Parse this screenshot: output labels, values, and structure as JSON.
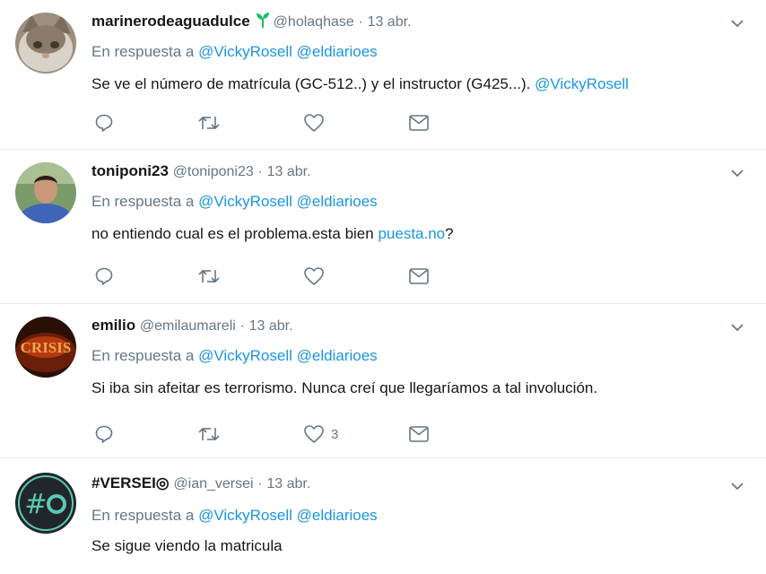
{
  "colors": {
    "link": "#1b95e0",
    "muted": "#657786",
    "text": "#14171a",
    "sprout": "#17bf63"
  },
  "tweets": [
    {
      "name": "marinerodeaguadulce",
      "handle": "@holaqhase",
      "dot": "·",
      "time": "13 abr.",
      "reply_prefix": "En respuesta a",
      "mentions": [
        "@VickyRosell",
        "@eldiarioes"
      ],
      "text": "Se ve el número de matrícula (GC-512..) y el instructor (G425...).",
      "text_link": "@VickyRosell",
      "text_suffix": "",
      "like_count": "",
      "icons": [
        "reply-icon",
        "retweet-icon",
        "heart-icon",
        "message-icon"
      ]
    },
    {
      "name": "toniponi23",
      "handle": "@toniponi23",
      "dot": "·",
      "time": "13 abr.",
      "reply_prefix": "En respuesta a",
      "mentions": [
        "@VickyRosell",
        "@eldiarioes"
      ],
      "text": "no entiendo cual es el problema.esta bien",
      "text_link": "puesta.no",
      "text_suffix": "?",
      "like_count": ""
    },
    {
      "name": "emilio",
      "handle": "@emilaumareli",
      "dot": "·",
      "time": "13 abr.",
      "reply_prefix": "En respuesta a",
      "mentions": [
        "@VickyRosell",
        "@eldiarioes"
      ],
      "text": "Si iba sin afeitar es terrorismo. Nunca creí que llegaríamos a tal involución.",
      "text_link": "",
      "text_suffix": "",
      "like_count": "3"
    },
    {
      "name": "#VERSEI◎",
      "handle": "@ian_versei",
      "dot": "·",
      "time": "13 abr.",
      "reply_prefix": "En respuesta a",
      "mentions": [
        "@VickyRosell",
        "@eldiarioes"
      ],
      "text": "Se sigue viendo la matricula",
      "text_link": "",
      "text_suffix": "",
      "like_count": ""
    }
  ],
  "avatar_texts": {
    "emilio": "CRISIS"
  }
}
